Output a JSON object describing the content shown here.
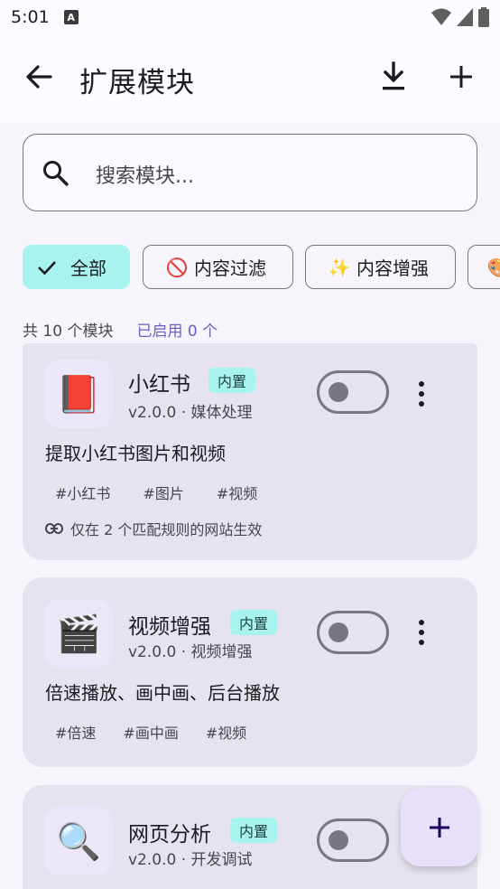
{
  "status": {
    "time": "5:01",
    "a_label": "A"
  },
  "app_bar": {
    "title": "扩展模块"
  },
  "search": {
    "placeholder": "搜索模块..."
  },
  "chips": [
    {
      "label": "全部",
      "icon": "check-icon",
      "active": true
    },
    {
      "label": "内容过滤",
      "icon": "no-entry-icon",
      "emoji": "🚫",
      "active": false
    },
    {
      "label": "内容增强",
      "icon": "sparkles-icon",
      "emoji": "✨",
      "active": false
    },
    {
      "label": "",
      "icon": "palette-icon",
      "emoji": "🎨",
      "active": false
    }
  ],
  "summary": {
    "total": "共 10 个模块",
    "enabled": "已启用 0 个"
  },
  "modules": [
    {
      "name": "小红书",
      "badge": "内置",
      "meta": "v2.0.0 · 媒体处理",
      "description": "提取小红书图片和视频",
      "tags": [
        "#小红书",
        "#图片",
        "#视频"
      ],
      "rule": "仅在 2 个匹配规则的网站生效",
      "icon": "book-icon",
      "emoji": "📕",
      "enabled": false
    },
    {
      "name": "视频增强",
      "badge": "内置",
      "meta": "v2.0.0 · 视频增强",
      "description": "倍速播放、画中画、后台播放",
      "tags": [
        "#倍速",
        "#画中画",
        "#视频"
      ],
      "icon": "clapper-icon",
      "emoji": "🎬",
      "enabled": false
    },
    {
      "name": "网页分析",
      "badge": "内置",
      "meta": "v2.0.0 · 开发调试",
      "icon": "magnifier-icon",
      "emoji": "🔍",
      "enabled": false
    }
  ],
  "colors": {
    "accent_chip": "#a8f3f0",
    "card_bg": "#e6e3ef",
    "enabled_text": "#6b5fbf",
    "fab_bg": "#e8e0fb"
  }
}
